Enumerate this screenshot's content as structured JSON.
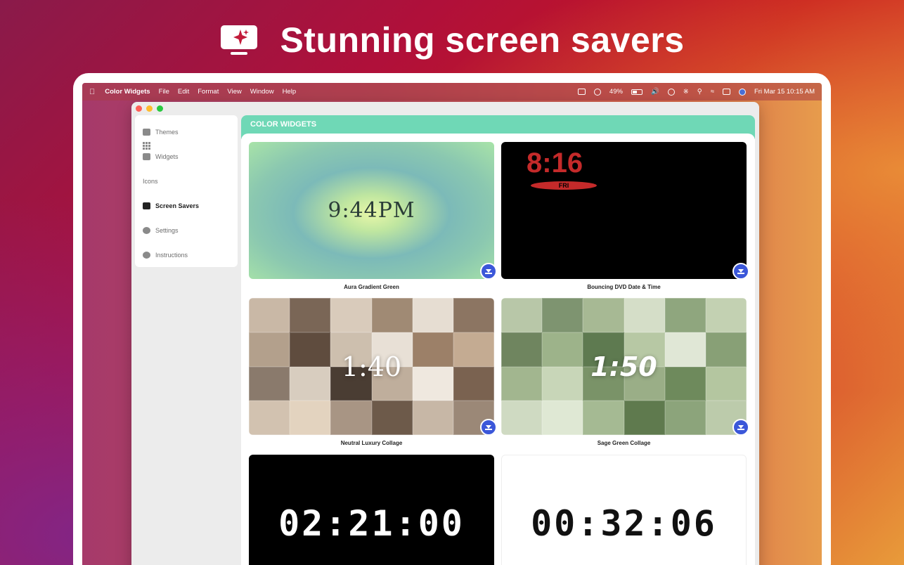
{
  "headline": {
    "icon": "monitor-sparkle-icon",
    "text": "Stunning screen savers"
  },
  "menubar": {
    "app_name": "Color Widgets",
    "menus": [
      "File",
      "Edit",
      "Format",
      "View",
      "Window",
      "Help"
    ],
    "battery": "49%",
    "datetime": "Fri Mar 15  10:15 AM"
  },
  "sidebar": {
    "items": [
      {
        "label": "Themes",
        "icon": "themes-icon"
      },
      {
        "label": "Widgets",
        "icon": "widgets-icon"
      },
      {
        "label": "Icons",
        "icon": "icons-grid-icon"
      },
      {
        "label": "Screen Savers",
        "icon": "screen-saver-icon",
        "active": true
      },
      {
        "label": "Settings",
        "icon": "gear-icon"
      },
      {
        "label": "Instructions",
        "icon": "help-icon"
      }
    ]
  },
  "main": {
    "header": "COLOR WIDGETS",
    "cards": [
      {
        "caption": "Aura Gradient Green",
        "time": "9:44PM"
      },
      {
        "caption": "Bouncing DVD Date & Time",
        "time": "8:16",
        "day": "FRI"
      },
      {
        "caption": "Neutral Luxury Collage",
        "time": "1:40"
      },
      {
        "caption": "Sage Green Collage",
        "time": "1:50"
      },
      {
        "caption": "",
        "time": "02:21:00"
      },
      {
        "caption": "",
        "time": "00:32:06"
      }
    ]
  },
  "colors": {
    "accent": "#6fd8b6",
    "download": "#3b57d9",
    "dvd_red": "#c42a2a"
  }
}
